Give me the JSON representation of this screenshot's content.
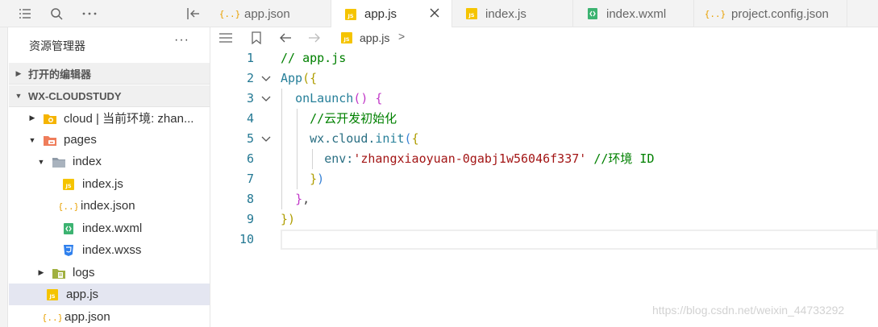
{
  "toolbar": {
    "icons": [
      "list-icon",
      "search-icon",
      "more-icon",
      "collapse-sidebar-icon"
    ]
  },
  "explorer": {
    "title": "资源管理器",
    "more": "···",
    "sections": [
      {
        "label": "打开的编辑器",
        "expanded": false
      },
      {
        "label": "WX-CLOUDSTUDY",
        "expanded": true
      }
    ],
    "tree": [
      {
        "label": "cloud | 当前环境: zhan...",
        "icon": "cloud-folder-icon",
        "expanded": false
      },
      {
        "label": "pages",
        "icon": "pages-folder-icon",
        "expanded": true
      },
      {
        "label": "index",
        "icon": "folder-icon",
        "expanded": true
      },
      {
        "label": "index.js",
        "icon": "js-file-icon"
      },
      {
        "label": "index.json",
        "icon": "json-file-icon"
      },
      {
        "label": "index.wxml",
        "icon": "wxml-file-icon"
      },
      {
        "label": "index.wxss",
        "icon": "wxss-file-icon"
      },
      {
        "label": "logs",
        "icon": "folder-icon",
        "expanded": false
      },
      {
        "label": "app.js",
        "icon": "js-file-icon",
        "selected": true
      },
      {
        "label": "app.json",
        "icon": "json-file-icon"
      }
    ]
  },
  "tabs": [
    {
      "label": "app.json",
      "icon": "json-file-icon",
      "active": false
    },
    {
      "label": "app.js",
      "icon": "js-file-icon",
      "active": true
    },
    {
      "label": "index.js",
      "icon": "js-file-icon",
      "active": false
    },
    {
      "label": "index.wxml",
      "icon": "wxml-file-icon",
      "active": false
    },
    {
      "label": "project.config.json",
      "icon": "json-file-icon",
      "active": false
    }
  ],
  "breadcrumb": {
    "file": "app.js",
    "separator": ">"
  },
  "editor": {
    "line_numbers": [
      "1",
      "2",
      "3",
      "4",
      "5",
      "6",
      "7",
      "8",
      "9",
      "10"
    ],
    "code": {
      "l1": "// app.js",
      "l2_fn": "App",
      "l2_br": "({",
      "l3_fn": "onLaunch",
      "l3_br1": "()",
      "l3_br2": "{",
      "l4": "//云开发初始化",
      "l5_obj": "wx.cloud.",
      "l5_fn": "init",
      "l5_br1": "(",
      "l5_br2": "{",
      "l6_key": "env:",
      "l6_str": "'zhangxiaoyuan-0gabj1w56046f337'",
      "l6_com": "//环境 ID",
      "l7_br": "}",
      "l7_br2": ")",
      "l8_br": "}",
      "l8_pun": ",",
      "l9_br": "}",
      "l9_br2": ")"
    }
  },
  "watermark": "https://blog.csdn.net/weixin_44733292",
  "colors": {
    "comment": "#008000",
    "string": "#a31515",
    "line_number": "#237893",
    "selected_row": "#e4e6f1",
    "js_icon": "#f5c400"
  }
}
